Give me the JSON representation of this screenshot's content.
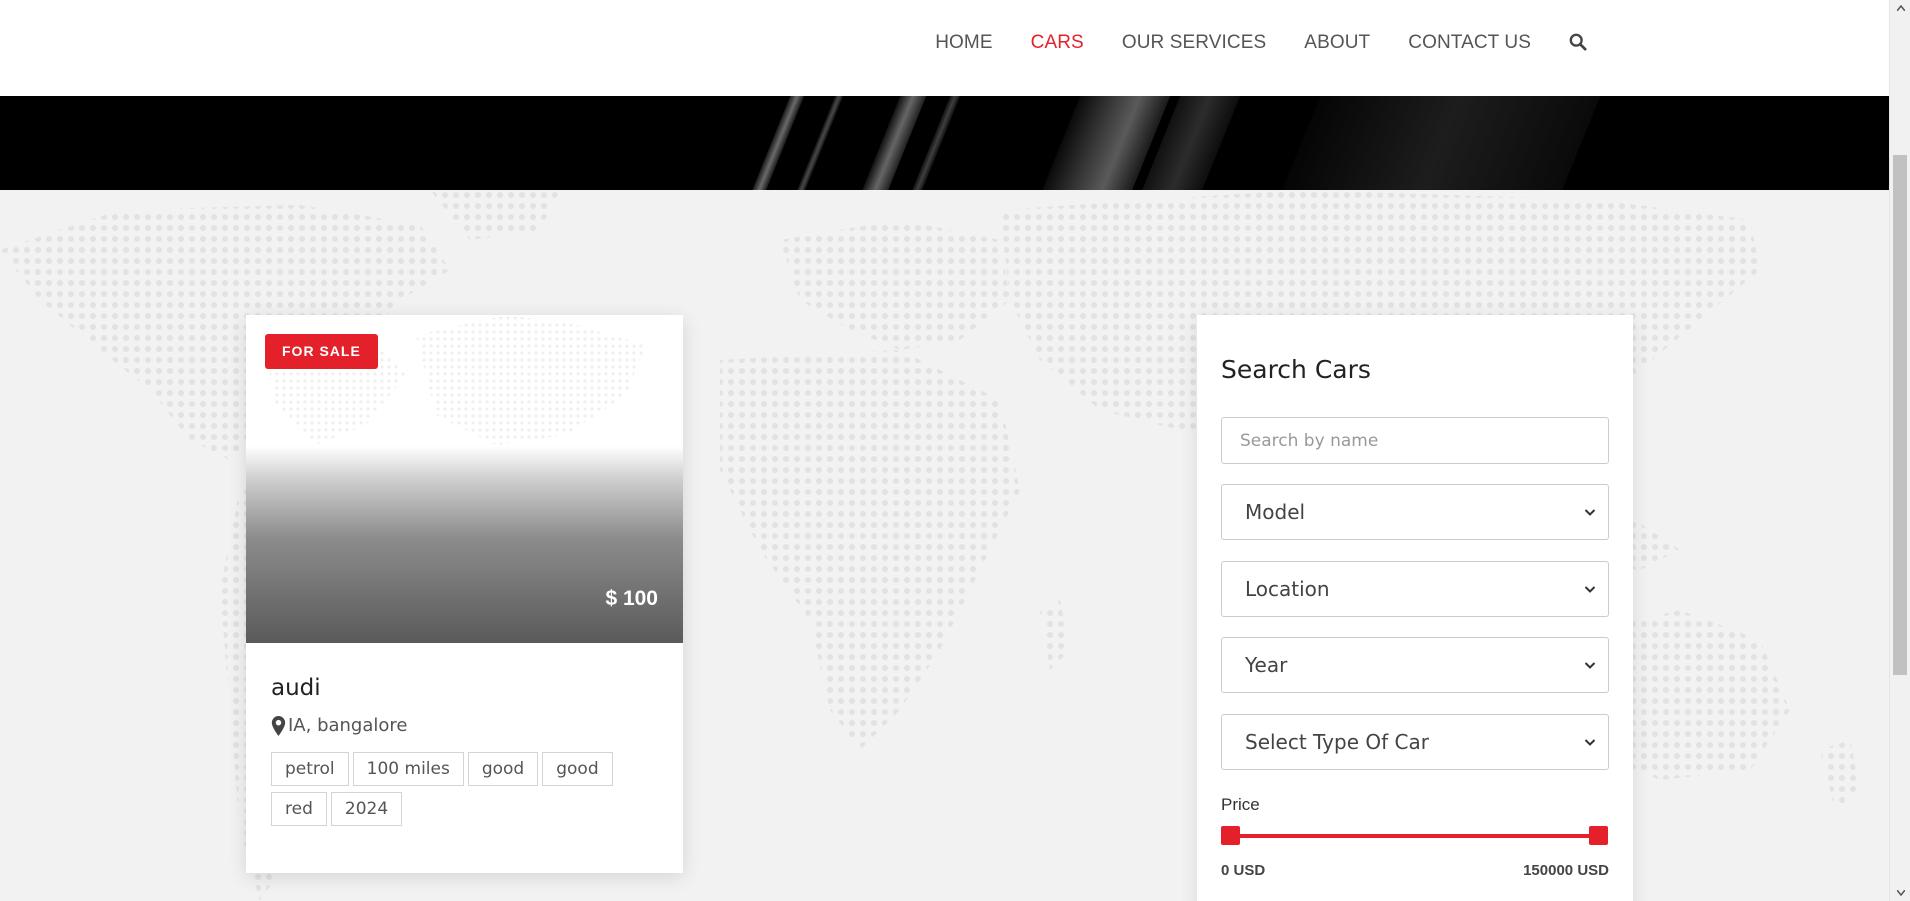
{
  "nav": {
    "items": [
      {
        "label": "HOME",
        "active": false
      },
      {
        "label": "CARS",
        "active": true
      },
      {
        "label": "OUR SERVICES",
        "active": false
      },
      {
        "label": "ABOUT",
        "active": false
      },
      {
        "label": "CONTACT US",
        "active": false
      }
    ],
    "search_icon": "search-icon"
  },
  "colors": {
    "accent": "#e4212a",
    "nav_text": "#555555",
    "background": "#f2f2f2"
  },
  "card": {
    "badge": "FOR SALE",
    "price": "$ 100",
    "name": "audi",
    "location_icon": "map-marker-icon",
    "location": "IA, bangalore",
    "tags": [
      "petrol",
      "100 miles",
      "good",
      "good",
      "red",
      "2024"
    ]
  },
  "search": {
    "title": "Search Cars",
    "name_placeholder": "Search by name",
    "model_select": "Model",
    "location_select": "Location",
    "year_select": "Year",
    "type_select": "Select Type Of Car",
    "price_label": "Price",
    "price_min": "0 USD",
    "price_max": "150000 USD"
  }
}
